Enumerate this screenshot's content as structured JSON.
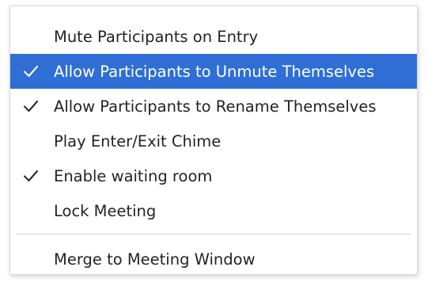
{
  "menu": {
    "items": [
      {
        "label": "Mute Participants on Entry",
        "checked": false,
        "highlighted": false
      },
      {
        "label": "Allow Participants to Unmute Themselves",
        "checked": true,
        "highlighted": true
      },
      {
        "label": "Allow Participants to Rename Themselves",
        "checked": true,
        "highlighted": false
      },
      {
        "label": "Play Enter/Exit Chime",
        "checked": false,
        "highlighted": false
      },
      {
        "label": "Enable waiting room",
        "checked": true,
        "highlighted": false
      },
      {
        "label": "Lock Meeting",
        "checked": false,
        "highlighted": false
      }
    ],
    "footer_item": {
      "label": "Merge to Meeting Window"
    }
  },
  "colors": {
    "highlight": "#2f6fd5",
    "text": "#232323",
    "check_icon": "#2b2b2b",
    "check_icon_on_highlight": "#ffffff"
  },
  "icons": {
    "check": "checkmark-icon"
  }
}
